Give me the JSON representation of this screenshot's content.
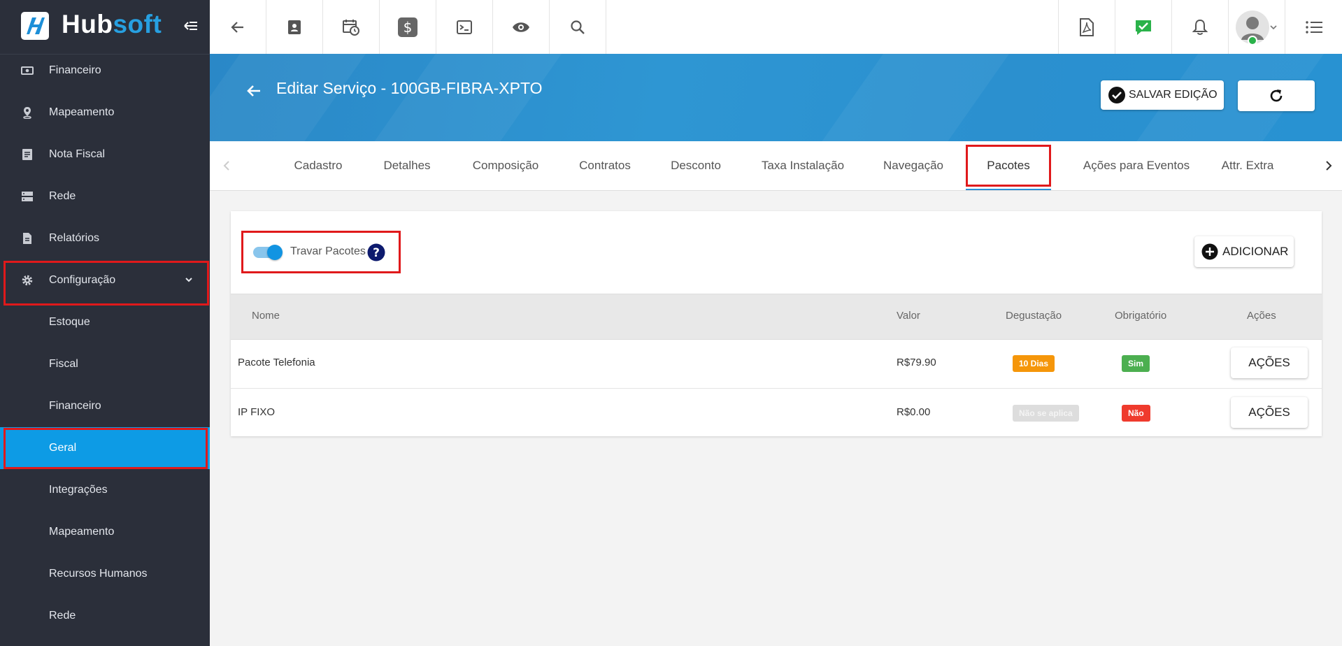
{
  "brand": {
    "part1": "Hub",
    "part2": "soft"
  },
  "colors": {
    "sidebar_bg": "#2b2f3a",
    "accent": "#0d9be5",
    "header_bg": "#2b90cf",
    "highlight_red": "#e0191b",
    "badge_orange": "#f5960a",
    "badge_green": "#4caf50",
    "badge_red": "#ef3b2d",
    "badge_grey": "#dddddd"
  },
  "sidebar": {
    "items": [
      {
        "label": "Financeiro",
        "icon": "money-icon"
      },
      {
        "label": "Mapeamento",
        "icon": "map-pin-icon"
      },
      {
        "label": "Nota Fiscal",
        "icon": "invoice-icon"
      },
      {
        "label": "Rede",
        "icon": "server-icon"
      },
      {
        "label": "Relatórios",
        "icon": "report-icon"
      },
      {
        "label": "Configuração",
        "icon": "gear-icon",
        "expanded": true
      }
    ],
    "subitems": [
      {
        "label": "Estoque"
      },
      {
        "label": "Fiscal"
      },
      {
        "label": "Financeiro"
      },
      {
        "label": "Geral",
        "active": true
      },
      {
        "label": "Integrações"
      },
      {
        "label": "Mapeamento"
      },
      {
        "label": "Recursos Humanos"
      },
      {
        "label": "Rede"
      }
    ]
  },
  "topbar": {
    "left_icons": [
      "back-arrow-icon",
      "contact-card-icon",
      "calendar-clock-icon",
      "dollar-icon",
      "terminal-icon",
      "eye-icon",
      "search-icon"
    ],
    "right_icons": [
      "pdf-icon",
      "task-check-icon",
      "bell-icon",
      "user-avatar",
      "list-menu-icon"
    ]
  },
  "header": {
    "title": "Editar Serviço - 100GB-FIBRA-XPTO",
    "save_label": "SALVAR EDIÇÃO"
  },
  "tabs": [
    {
      "label": "Cadastro"
    },
    {
      "label": "Detalhes"
    },
    {
      "label": "Composição"
    },
    {
      "label": "Contratos"
    },
    {
      "label": "Desconto"
    },
    {
      "label": "Taxa Instalação"
    },
    {
      "label": "Navegação"
    },
    {
      "label": "Pacotes",
      "active": true
    },
    {
      "label": "Ações para Eventos"
    },
    {
      "label": "Attr. Extra"
    }
  ],
  "packages": {
    "lock_label": "Travar Pacotes",
    "lock_enabled": true,
    "add_label": "ADICIONAR",
    "columns": [
      "Nome",
      "Valor",
      "Degustação",
      "Obrigatório",
      "Ações"
    ],
    "rows": [
      {
        "name": "Pacote Telefonia",
        "value": "R$79.90",
        "trial": "10 Dias",
        "required": "Sim",
        "action": "AÇÕES"
      },
      {
        "name": "IP FIXO",
        "value": "R$0.00",
        "trial": "Não se aplica",
        "required": "Não",
        "action": "AÇÕES"
      }
    ]
  }
}
